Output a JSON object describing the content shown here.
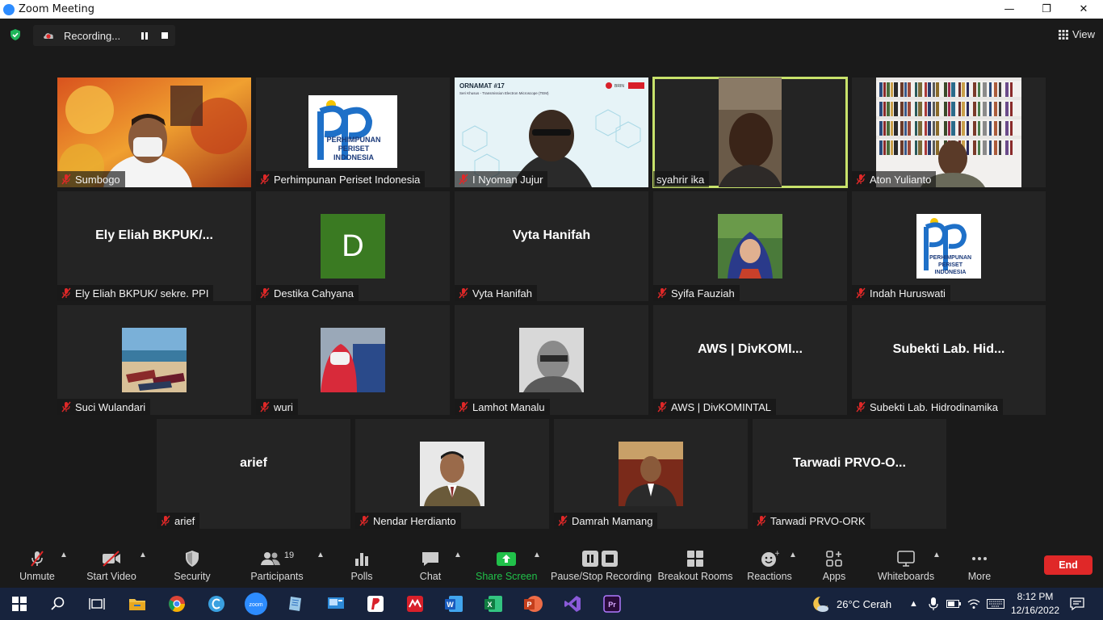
{
  "window": {
    "title": "Zoom Meeting",
    "min": "—",
    "max": "❐",
    "close": "✕"
  },
  "recording": {
    "label": "Recording..."
  },
  "view": {
    "label": "View"
  },
  "tiles": [
    {
      "name": "Sumbogo",
      "type": "video"
    },
    {
      "name": "Perhimpunan Periset Indonesia",
      "type": "logo"
    },
    {
      "name": "I Nyoman Jujur",
      "type": "slides"
    },
    {
      "name": "syahrir ika",
      "type": "video",
      "active": true
    },
    {
      "name": "Aton Yulianto",
      "type": "video"
    },
    {
      "name": "Ely Eliah BKPUK/ sekre.  PPI",
      "display": "Ely  Eliah  BKPUK/...",
      "type": "name"
    },
    {
      "name": "Destika Cahyana",
      "type": "initial",
      "initial": "D"
    },
    {
      "name": "Vyta Hanifah",
      "display": "Vyta Hanifah",
      "type": "name"
    },
    {
      "name": "Syifa Fauziah",
      "type": "avatar"
    },
    {
      "name": "Indah Huruswati",
      "type": "avatar-logo"
    },
    {
      "name": "Suci Wulandari",
      "type": "avatar"
    },
    {
      "name": "wuri",
      "type": "avatar"
    },
    {
      "name": "Lamhot Manalu",
      "type": "avatar"
    },
    {
      "name": "AWS | DivKOMINTAL",
      "display": "AWS | DivKOMI...",
      "type": "name"
    },
    {
      "name": "Subekti Lab. Hidrodinamika",
      "display": "Subekti Lab. Hid...",
      "type": "name"
    },
    {
      "name": "arief",
      "display": "arief",
      "type": "name"
    },
    {
      "name": "Nendar Herdianto",
      "type": "avatar"
    },
    {
      "name": "Damrah Mamang",
      "type": "avatar"
    },
    {
      "name": "Tarwadi PRVO-ORK",
      "display": "Tarwadi PRVO-O...",
      "type": "name"
    }
  ],
  "logo_text": {
    "line1": "PERHIMPUNAN",
    "line2": "PERISET",
    "line3": "INDONESIA"
  },
  "slide": {
    "title": "ORNAMAT #17",
    "subtitle": "Seri Khusus - Transmission Electron Microscope (TEM)",
    "org": "BRIN"
  },
  "toolbar": {
    "unmute": "Unmute",
    "start_video": "Start Video",
    "security": "Security",
    "participants": "Participants",
    "participants_count": "19",
    "polls": "Polls",
    "chat": "Chat",
    "share_screen": "Share Screen",
    "pause_stop_recording": "Pause/Stop Recording",
    "breakout_rooms": "Breakout Rooms",
    "reactions": "Reactions",
    "apps": "Apps",
    "whiteboards": "Whiteboards",
    "more": "More",
    "end": "End",
    "share_color": "#21c14a",
    "end_color": "#e02828"
  },
  "taskbar": {
    "weather": "26°C  Cerah",
    "time": "8:12 PM",
    "date": "12/16/2022",
    "zoom_label": "zoom"
  }
}
